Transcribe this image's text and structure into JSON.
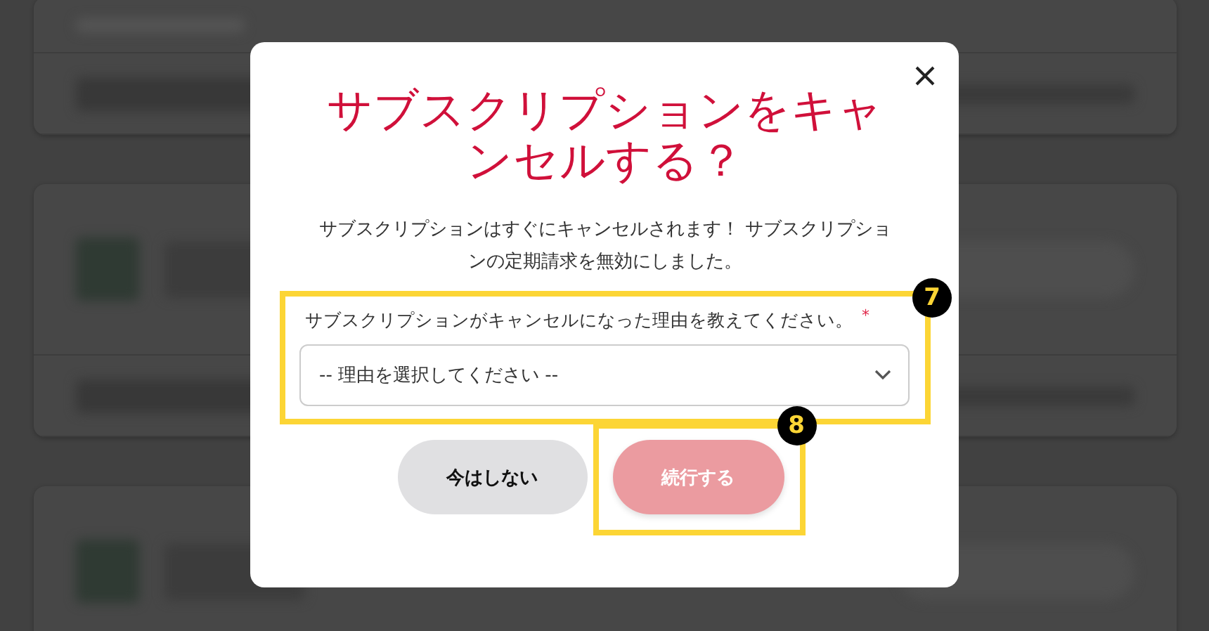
{
  "dialog": {
    "title": "サブスクリプションをキャンセルする？",
    "message": "サブスクリプションはすぐにキャンセルされます！ サブスクリプションの定期請求を無効にしました。",
    "reason_field": {
      "label": "サブスクリプションがキャンセルになった理由を教えてください。",
      "required_mark": "*",
      "value": "-- 理由を選択してください --",
      "annotation": "7"
    },
    "buttons": [
      {
        "label": "今はしない",
        "kind": "secondary",
        "disabled": false
      },
      {
        "label": "続行する",
        "kind": "primary",
        "disabled": true,
        "annotation": "8"
      }
    ]
  }
}
